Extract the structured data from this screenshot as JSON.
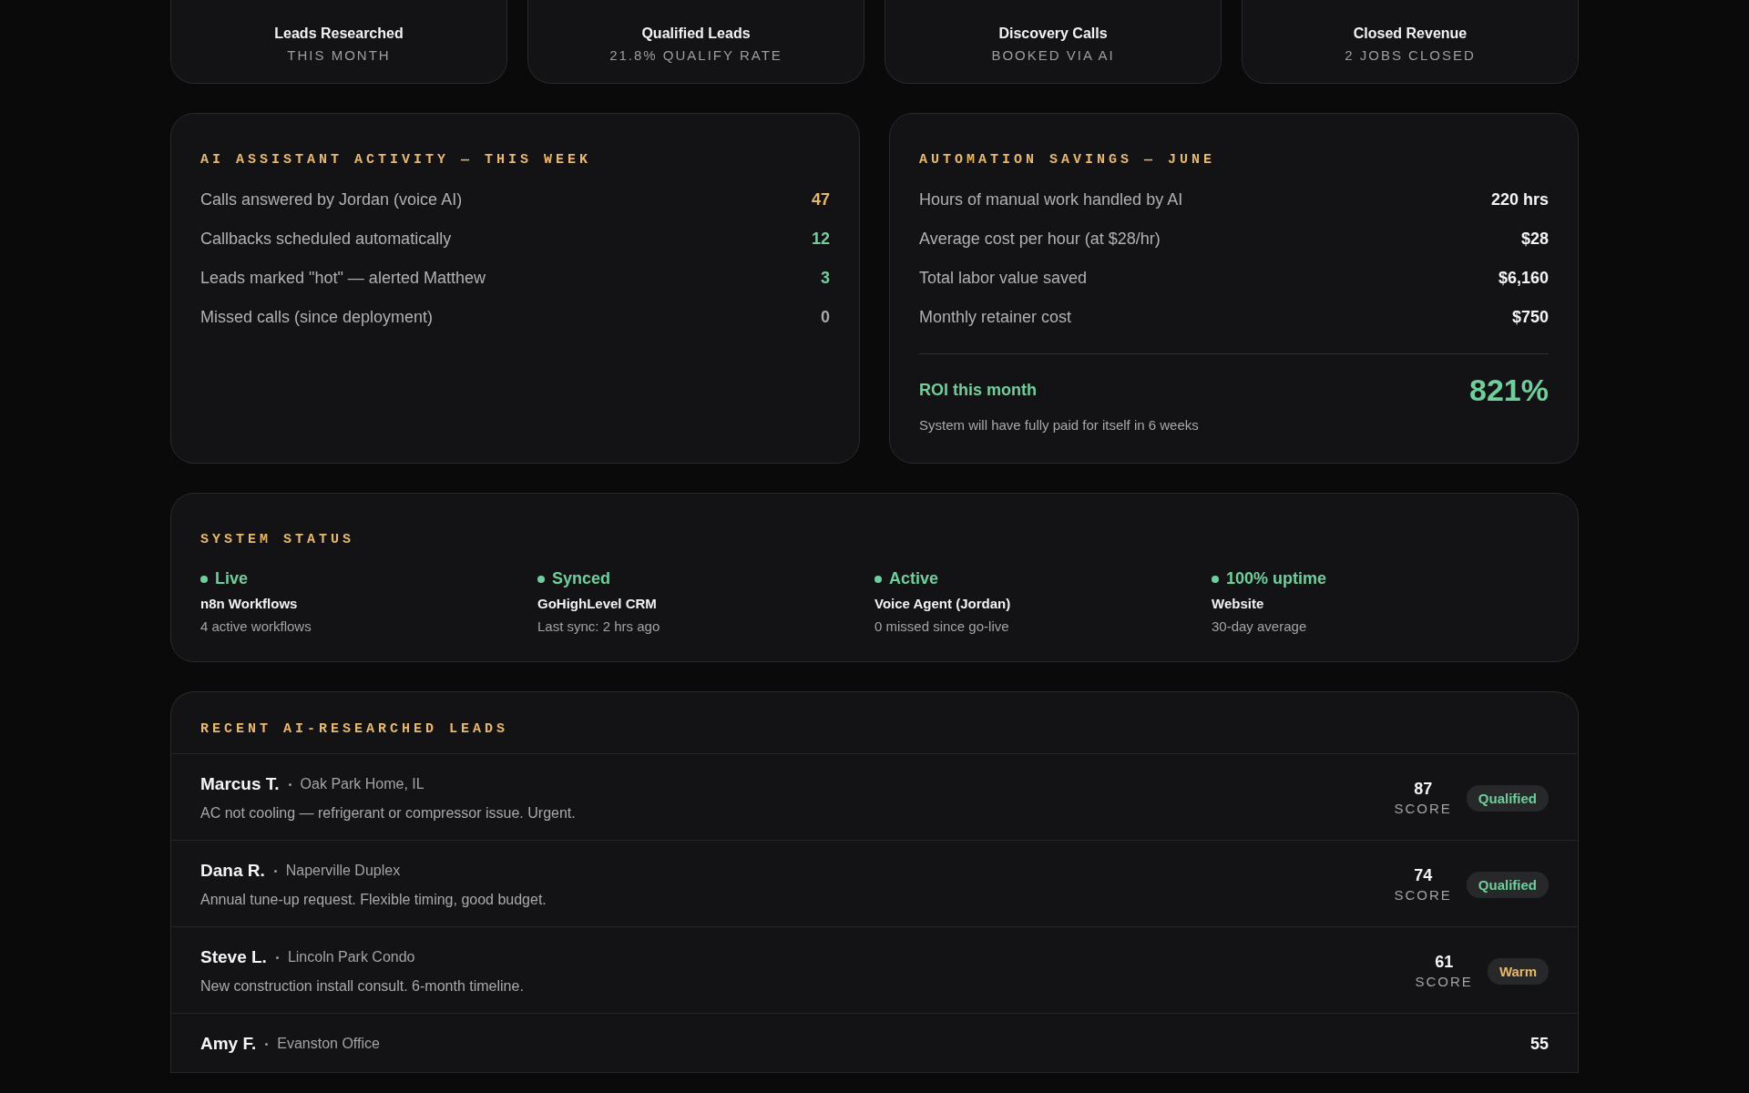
{
  "stats": [
    {
      "label": "Leads Researched",
      "sub": "THIS MONTH"
    },
    {
      "label": "Qualified Leads",
      "sub": "21.8% QUALIFY RATE"
    },
    {
      "label": "Discovery Calls",
      "sub": "BOOKED VIA AI"
    },
    {
      "label": "Closed Revenue",
      "sub": "2 JOBS CLOSED"
    }
  ],
  "activity": {
    "title": "AI ASSISTANT ACTIVITY — THIS WEEK",
    "rows": [
      {
        "label": "Calls answered by Jordan (voice AI)",
        "value": "47",
        "color": "#e8b86a"
      },
      {
        "label": "Callbacks scheduled automatically",
        "value": "12",
        "color": "#6fcf9c"
      },
      {
        "label": "Leads marked \"hot\" — alerted Matthew",
        "value": "3",
        "color": "#6fcf9c"
      },
      {
        "label": "Missed calls (since deployment)",
        "value": "0",
        "color": "#a9a9a9"
      }
    ]
  },
  "savings": {
    "title": "AUTOMATION SAVINGS — JUNE",
    "rows": [
      {
        "label": "Hours of manual work handled by AI",
        "value": "220 hrs"
      },
      {
        "label": "Average cost per hour (at $28/hr)",
        "value": "$28"
      },
      {
        "label": "Total labor value saved",
        "value": "$6,160"
      },
      {
        "label": "Monthly retainer cost",
        "value": "$750"
      }
    ],
    "roi_label": "ROI this month",
    "roi_value": "821%",
    "note": "System will have fully paid for itself in 6 weeks"
  },
  "system_status": {
    "title": "SYSTEM STATUS",
    "items": [
      {
        "status": "Live",
        "name": "n8n Workflows",
        "detail": "4 active workflows",
        "color": "#6fcf9c"
      },
      {
        "status": "Synced",
        "name": "GoHighLevel CRM",
        "detail": "Last sync: 2 hrs ago",
        "color": "#6fcf9c"
      },
      {
        "status": "Active",
        "name": "Voice Agent (Jordan)",
        "detail": "0 missed since go-live",
        "color": "#6fcf9c"
      },
      {
        "status": "100% uptime",
        "name": "Website",
        "detail": "30-day average",
        "color": "#6fcf9c"
      }
    ]
  },
  "leads": {
    "title": "RECENT AI-RESEARCHED LEADS",
    "rows": [
      {
        "name": "Marcus T.",
        "location": "Oak Park Home, IL",
        "summary": "AC not cooling — refrigerant or compressor issue. Urgent.",
        "score": "87",
        "score_label": "SCORE",
        "badge": {
          "label": "Qualified",
          "color": "#6fcf9c"
        }
      },
      {
        "name": "Dana R.",
        "location": "Naperville Duplex",
        "summary": "Annual tune-up request. Flexible timing, good budget.",
        "score": "74",
        "score_label": "SCORE",
        "badge": {
          "label": "Qualified",
          "color": "#6fcf9c"
        }
      },
      {
        "name": "Steve L.",
        "location": "Lincoln Park Condo",
        "summary": "New construction install consult. 6-month timeline.",
        "score": "61",
        "score_label": "SCORE",
        "badge": {
          "label": "Warm",
          "color": "#e8b86a"
        }
      },
      {
        "name": "Amy F.",
        "location": "Evanston Office",
        "score": "55"
      }
    ]
  }
}
